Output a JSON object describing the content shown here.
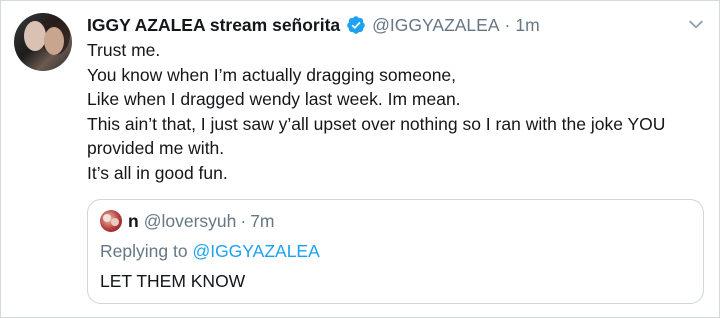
{
  "tweet": {
    "author_name": "IGGY AZALEA stream señorita",
    "handle": "@IGGYAZALEA",
    "separator": "·",
    "time": "1m",
    "verified": true,
    "lines": [
      "Trust me.",
      "You know when I’m actually dragging someone,",
      "Like when I dragged wendy last week. Im mean.",
      "This ain’t that, I just saw y’all upset over nothing so I ran with the joke YOU provided me with.",
      "It’s all in good fun."
    ]
  },
  "quoted_tweet": {
    "author_name": "n",
    "handle": "@loversyuh",
    "separator": "·",
    "time": "7m",
    "replying_prefix": "Replying to",
    "replying_to": "@IGGYAZALEA",
    "text": "LET THEM KNOW"
  },
  "colors": {
    "text": "#14171a",
    "secondary": "#657786",
    "accent": "#1da1f2",
    "border": "#ccd6dd"
  },
  "icons": {
    "verified": "verified-badge-icon",
    "menu": "chevron-down-icon"
  }
}
